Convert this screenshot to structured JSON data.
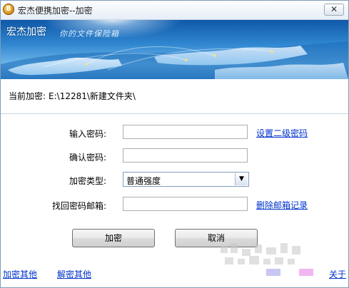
{
  "window": {
    "title": "宏杰便携加密--加密",
    "app_icon_glyph": "🔒",
    "close_label": "✕"
  },
  "banner": {
    "brand": "宏杰加密",
    "slogan": "你的文件保险箱"
  },
  "current": {
    "label": "当前加密:",
    "path": "E:\\12281\\新建文件夹\\"
  },
  "form": {
    "password_label": "输入密码:",
    "confirm_label": "确认密码:",
    "type_label": "加密类型:",
    "type_value": "普通强度",
    "email_label": "找回密码邮箱:",
    "password_value": "",
    "confirm_value": "",
    "email_value": "",
    "set_second_pwd_link": "设置二级密码",
    "delete_email_link": "删除邮箱记录"
  },
  "buttons": {
    "encrypt": "加密",
    "cancel": "取消"
  },
  "footer": {
    "encrypt_other": "加密其他",
    "decrypt_other": "解密其他",
    "about": "关于"
  },
  "colors": {
    "link": "#0033cc",
    "banner": "#2f86cf"
  }
}
